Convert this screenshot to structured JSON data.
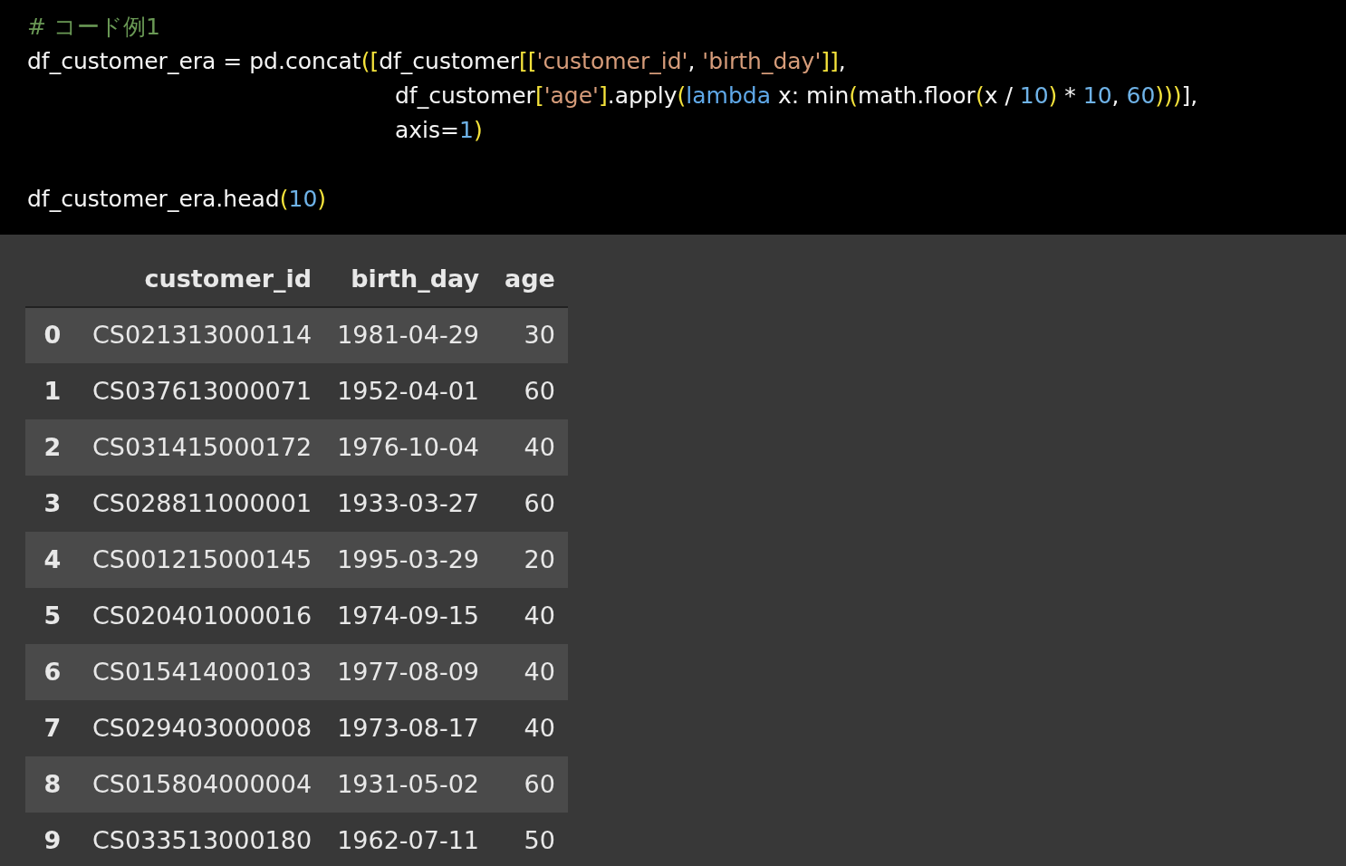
{
  "code_cell": {
    "lines": [
      {
        "kind": "statement",
        "tokens": [
          {
            "kind": "comment",
            "text": "# コード例1"
          }
        ]
      },
      {
        "kind": "statement",
        "tokens": [
          {
            "kind": "plain",
            "text": "df_customer_era = pd.concat"
          },
          {
            "kind": "bracket",
            "text": "(["
          },
          {
            "kind": "plain",
            "text": "df_customer"
          },
          {
            "kind": "bracket",
            "text": "[["
          },
          {
            "kind": "string",
            "text": "'customer_id'"
          },
          {
            "kind": "plain",
            "text": ", "
          },
          {
            "kind": "string",
            "text": "'birth_day'"
          },
          {
            "kind": "bracket",
            "text": "]]"
          },
          {
            "kind": "plain",
            "text": ","
          }
        ]
      },
      {
        "kind": "continuation",
        "tokens": [
          {
            "kind": "plain",
            "text": "df_customer"
          },
          {
            "kind": "bracket",
            "text": "["
          },
          {
            "kind": "string",
            "text": "'age'"
          },
          {
            "kind": "bracket",
            "text": "]"
          },
          {
            "kind": "plain",
            "text": ".apply"
          },
          {
            "kind": "bracket",
            "text": "("
          },
          {
            "kind": "keyword",
            "text": "lambda"
          },
          {
            "kind": "plain",
            "text": " x: min"
          },
          {
            "kind": "bracket",
            "text": "("
          },
          {
            "kind": "plain",
            "text": "math.floor"
          },
          {
            "kind": "bracket",
            "text": "("
          },
          {
            "kind": "plain",
            "text": "x / "
          },
          {
            "kind": "number",
            "text": "10"
          },
          {
            "kind": "bracket",
            "text": ")"
          },
          {
            "kind": "plain",
            "text": " * "
          },
          {
            "kind": "number",
            "text": "10"
          },
          {
            "kind": "plain",
            "text": ", "
          },
          {
            "kind": "number",
            "text": "60"
          },
          {
            "kind": "bracket",
            "text": ")))"
          },
          {
            "kind": "plain",
            "text": "],"
          }
        ]
      },
      {
        "kind": "continuation",
        "tokens": [
          {
            "kind": "plain",
            "text": "axis="
          },
          {
            "kind": "number",
            "text": "1"
          },
          {
            "kind": "bracket",
            "text": ")"
          }
        ]
      },
      {
        "kind": "blank"
      },
      {
        "kind": "statement",
        "tokens": [
          {
            "kind": "plain",
            "text": "df_customer_era.head"
          },
          {
            "kind": "bracket",
            "text": "("
          },
          {
            "kind": "number",
            "text": "10"
          },
          {
            "kind": "bracket",
            "text": ")"
          }
        ]
      }
    ]
  },
  "output_table": {
    "columns": [
      "customer_id",
      "birth_day",
      "age"
    ],
    "rows": [
      {
        "index": "0",
        "cells": [
          "CS021313000114",
          "1981-04-29",
          "30"
        ]
      },
      {
        "index": "1",
        "cells": [
          "CS037613000071",
          "1952-04-01",
          "60"
        ]
      },
      {
        "index": "2",
        "cells": [
          "CS031415000172",
          "1976-10-04",
          "40"
        ]
      },
      {
        "index": "3",
        "cells": [
          "CS028811000001",
          "1933-03-27",
          "60"
        ]
      },
      {
        "index": "4",
        "cells": [
          "CS001215000145",
          "1995-03-29",
          "20"
        ]
      },
      {
        "index": "5",
        "cells": [
          "CS020401000016",
          "1974-09-15",
          "40"
        ]
      },
      {
        "index": "6",
        "cells": [
          "CS015414000103",
          "1977-08-09",
          "40"
        ]
      },
      {
        "index": "7",
        "cells": [
          "CS029403000008",
          "1973-08-17",
          "40"
        ]
      },
      {
        "index": "8",
        "cells": [
          "CS015804000004",
          "1931-05-02",
          "60"
        ]
      },
      {
        "index": "9",
        "cells": [
          "CS033513000180",
          "1962-07-11",
          "50"
        ]
      }
    ]
  }
}
